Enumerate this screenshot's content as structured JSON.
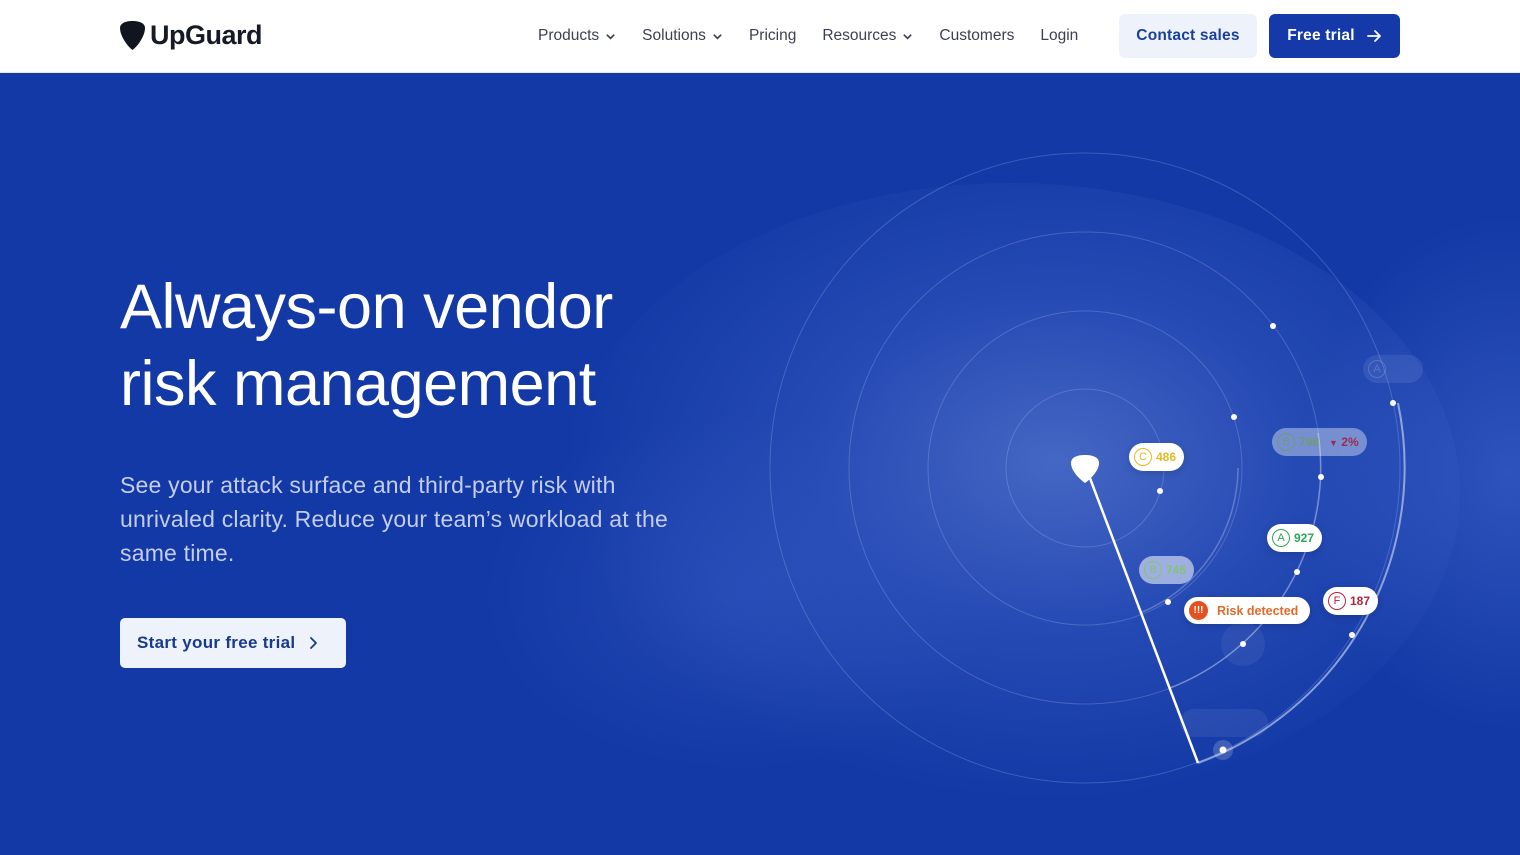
{
  "brand": {
    "name": "UpGuard",
    "logo_icon": "shield-pick-icon",
    "primary_color": "#1539a8",
    "hero_background": "#1339a6"
  },
  "nav": {
    "links": [
      {
        "label": "Products",
        "has_dropdown": true
      },
      {
        "label": "Solutions",
        "has_dropdown": true
      },
      {
        "label": "Pricing",
        "has_dropdown": false
      },
      {
        "label": "Resources",
        "has_dropdown": true
      },
      {
        "label": "Customers",
        "has_dropdown": false
      },
      {
        "label": "Login",
        "has_dropdown": false
      }
    ],
    "contact_label": "Contact sales",
    "trial_label": "Free trial",
    "trial_icon": "arrow-right-icon"
  },
  "hero": {
    "headline_line1": "Always-on vendor",
    "headline_line2": "risk management",
    "subtext": "See your attack surface and third-party risk with unrivaled clarity. Reduce your team’s workload at the same time.",
    "cta_label": "Start your free trial",
    "cta_icon": "chevron-right-icon"
  },
  "radar": {
    "badges": [
      {
        "id": "c486",
        "grade": "C",
        "score": "486",
        "color": "#e8b923"
      },
      {
        "id": "b798",
        "grade": "B",
        "score": "798",
        "delta": "2%",
        "delta_direction": "down",
        "color": "#6e9b78",
        "delta_color": "#9a2b52"
      },
      {
        "id": "a927",
        "grade": "A",
        "score": "927",
        "color": "#2ea55a"
      },
      {
        "id": "b745",
        "grade": "B",
        "score": "745",
        "color": "#86c27a"
      },
      {
        "id": "f187",
        "grade": "F",
        "score": "187",
        "color": "#b3243c"
      },
      {
        "id": "faint-top",
        "grade": "A",
        "score": "",
        "faded": true
      },
      {
        "id": "faint-bottom",
        "grade": "",
        "score": "",
        "faded": true
      }
    ],
    "alert": {
      "icon": "warning-icon",
      "icon_text": "!!!",
      "label": "Risk detected",
      "color": "#e36a2b"
    }
  }
}
